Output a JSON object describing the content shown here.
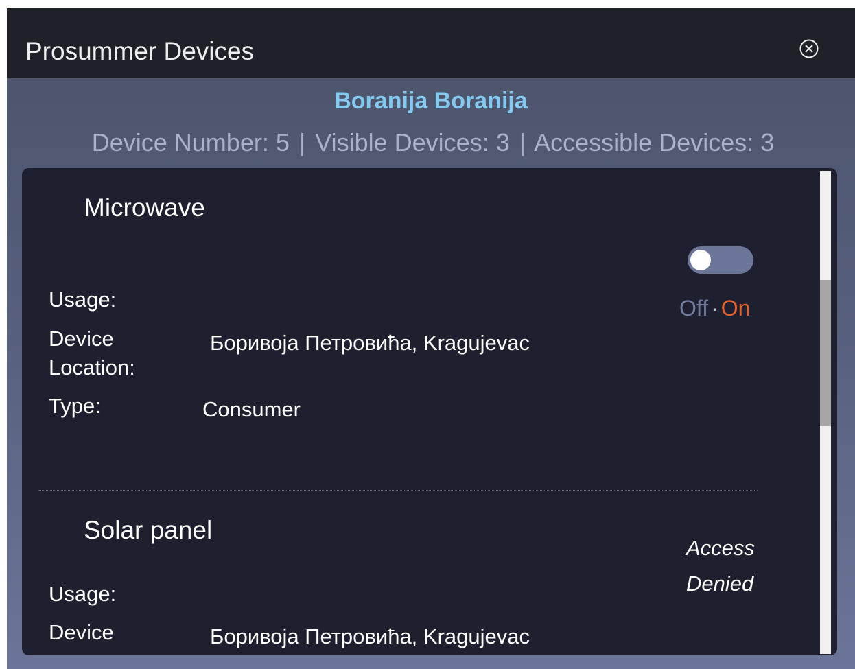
{
  "window": {
    "title": "Prosummer Devices",
    "close_icon": "circle-x-icon"
  },
  "owner": {
    "name": "Boranija Boranija"
  },
  "counts": {
    "device_number": "Device Number: 5",
    "visible_devices": "Visible Devices: 3",
    "accessible_devices": "Accessible Devices: 3",
    "separator": "|"
  },
  "devices": [
    {
      "name": "Microwave",
      "usage_label": "Usage:",
      "usage_value": "",
      "location_label_1": "Device",
      "location_label_2": "Location:",
      "location_value": "Боривоја Петровића, Kragujevac",
      "type_label": "Type:",
      "type_value": "Consumer",
      "toggle": {
        "off_label": "Off",
        "dot": "·",
        "on_label": "On",
        "state": "off"
      }
    },
    {
      "name": "Solar panel",
      "usage_label": "Usage:",
      "usage_value": "",
      "location_label_1": "Device",
      "location_value": "Боривоја Петровића, Kragujevac",
      "access_line_1": "Access",
      "access_line_2": "Denied"
    }
  ],
  "colors": {
    "title_bar": "#1f2129",
    "owner_name": "#84c9ef",
    "counts_text": "#a9b2c8",
    "panel": "#1f202f",
    "toggle_track": "#6c7699",
    "on_label": "#e4602f",
    "off_label": "#727d9d"
  }
}
